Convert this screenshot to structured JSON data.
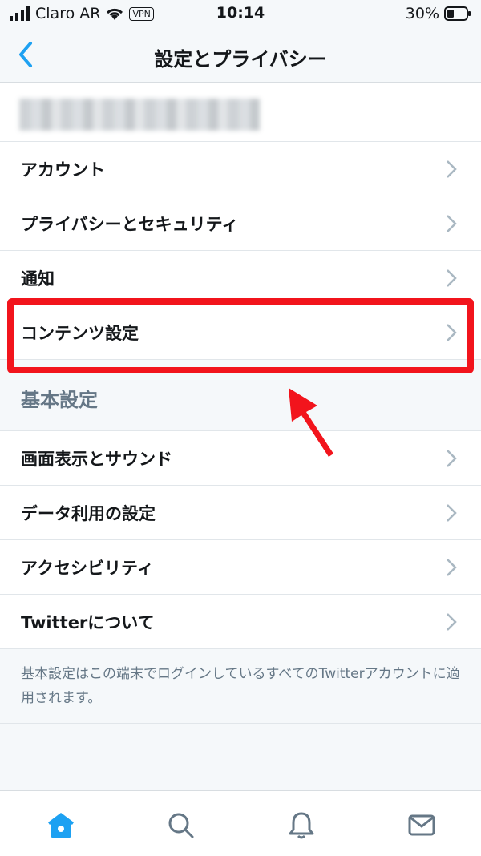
{
  "status_bar": {
    "carrier": "Claro AR",
    "vpn": "VPN",
    "time": "10:14",
    "battery": "30%"
  },
  "header": {
    "title": "設定とプライバシー",
    "back_icon": "chevron-left-icon"
  },
  "account_section": {
    "items": [
      {
        "label": "アカウント"
      },
      {
        "label": "プライバシーとセキュリティ"
      },
      {
        "label": "通知"
      },
      {
        "label": "コンテンツ設定"
      }
    ]
  },
  "general_section": {
    "header": "基本設定",
    "items": [
      {
        "label": "画面表示とサウンド"
      },
      {
        "label": "データ利用の設定"
      },
      {
        "label": "アクセシビリティ"
      },
      {
        "label": "Twitterについて"
      }
    ],
    "footnote": "基本設定はこの端末でログインしているすべてのTwitterアカウントに適用されます。"
  },
  "tab_bar": {
    "tabs": [
      "home-icon",
      "search-icon",
      "bell-icon",
      "mail-icon"
    ]
  },
  "colors": {
    "accent": "#1da1f2",
    "highlight": "#f2141c",
    "secondary_text": "#657786"
  }
}
